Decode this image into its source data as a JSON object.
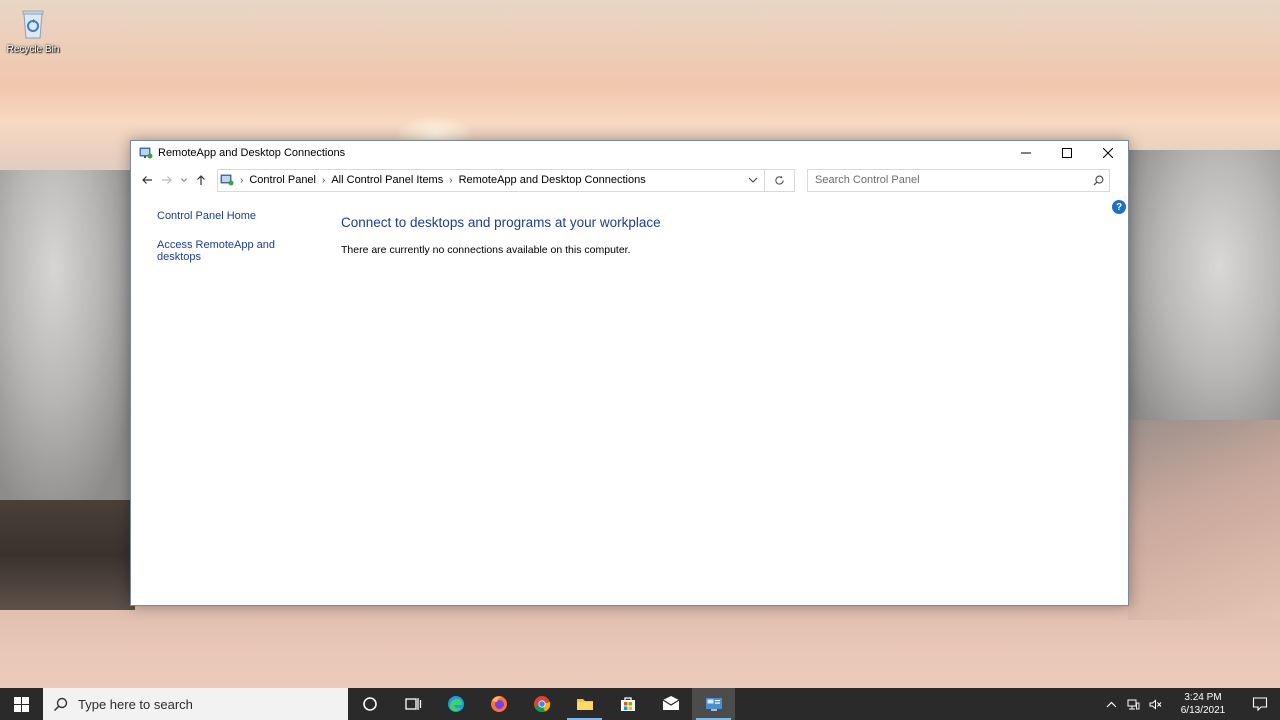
{
  "desktop": {
    "icons": [
      {
        "label": "Recycle Bin",
        "icon": "recycle-bin-icon"
      }
    ]
  },
  "window": {
    "title": "RemoteApp and Desktop Connections",
    "breadcrumbs": [
      "Control Panel",
      "All Control Panel Items",
      "RemoteApp and Desktop Connections"
    ],
    "search_placeholder": "Search Control Panel",
    "help_label": "?",
    "left_pane": {
      "links": [
        "Control Panel Home",
        "Access RemoteApp and desktops"
      ]
    },
    "main": {
      "heading": "Connect to desktops and programs at your workplace",
      "message": "There are currently no connections available on this computer."
    }
  },
  "taskbar": {
    "search_placeholder": "Type here to search",
    "pinned": [
      "cortana-icon",
      "task-view-icon",
      "edge-icon",
      "firefox-icon",
      "chrome-icon",
      "file-explorer-icon",
      "store-icon",
      "mail-icon",
      "control-panel-icon"
    ],
    "clock": {
      "time": "3:24 PM",
      "date": "6/13/2021"
    },
    "colors": {
      "background": "#2b2a2a",
      "accent": "#7fb7e8"
    }
  },
  "colors": {
    "link": "#1e3d8f",
    "help": "#1f6fc5"
  }
}
